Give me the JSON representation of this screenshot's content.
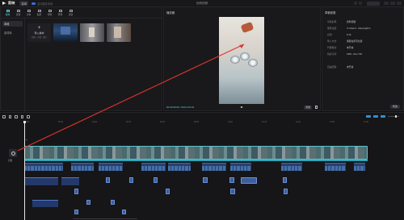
{
  "app": {
    "name": "剪映",
    "menu_label": "菜单",
    "auto_save": "自动保存本地",
    "window_title": "色鸭视频",
    "export_label": ""
  },
  "media": {
    "tools": [
      {
        "label": "媒体",
        "icon": "media-icon",
        "active": true
      },
      {
        "label": "音频",
        "icon": "audio-icon",
        "active": false
      },
      {
        "label": "文本",
        "icon": "text-icon",
        "active": false
      },
      {
        "label": "贴纸",
        "icon": "sticker-icon",
        "active": false
      },
      {
        "label": "特效",
        "icon": "effects-icon",
        "active": false
      },
      {
        "label": "转场",
        "icon": "transition-icon",
        "active": false
      },
      {
        "label": "滤镜",
        "icon": "filter-icon",
        "active": false
      }
    ],
    "side_items": [
      "本地",
      "素材库"
    ],
    "import_label": "导入素材",
    "import_sub": "视频、音频、图片",
    "thumbs": [
      {
        "duration": ""
      },
      {
        "duration": ""
      },
      {
        "duration": ""
      }
    ]
  },
  "player": {
    "title": "播放器",
    "timecode": "00:00:00:00 / 00:01:01:01",
    "ratio_label": "原始"
  },
  "details": {
    "title": "草稿参数",
    "rows": [
      {
        "key": "草稿名称:",
        "value": "色鸭视频"
      },
      {
        "key": "保存位置:",
        "value": "C:/Users/.../JianyingPro"
      },
      {
        "key": "比例:",
        "value": "9:16"
      },
      {
        "key": "导入方式:",
        "value": "保留在原有位置"
      },
      {
        "key": "代理模式:",
        "value": "未开启"
      },
      {
        "key": "色彩空间:",
        "value": "SDR - Rec.709"
      },
      {
        "key": "",
        "value": ""
      },
      {
        "key": "自由层级:",
        "value": "未开启"
      }
    ],
    "modify_label": "修改"
  },
  "timeline": {
    "ruler_ticks": [
      "00:00",
      "00:10",
      "00:20",
      "00:30",
      "00:40",
      "00:50",
      "01:00",
      "01:10",
      "01:20",
      "01:30",
      "01:40"
    ],
    "cover_label": "封面",
    "main_track_tag": "",
    "audio_rows": [
      {
        "segments": [
          {
            "label": "",
            "w": 48
          },
          {
            "label": "",
            "w": 28
          },
          {
            "label": "",
            "w": 30
          },
          {
            "label": "",
            "w": 30
          },
          {
            "label": "",
            "w": 28
          },
          {
            "label": "",
            "w": 30
          },
          {
            "label": "",
            "w": 26
          },
          {
            "label": "",
            "w": 26
          },
          {
            "label": "",
            "w": 26
          },
          {
            "label": "",
            "w": 14
          }
        ]
      }
    ]
  }
}
